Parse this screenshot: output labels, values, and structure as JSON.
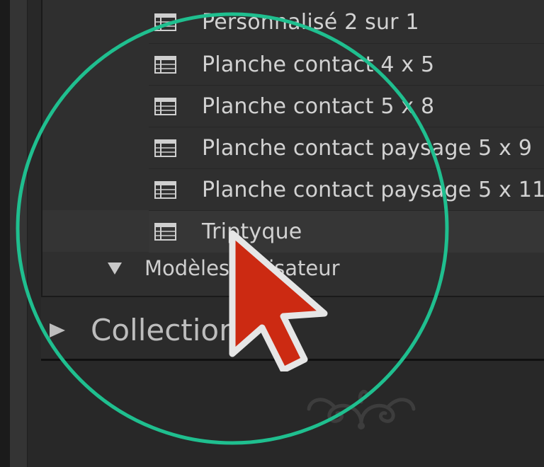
{
  "templates": {
    "items": [
      {
        "label": "Personnalisé 2 sur 1",
        "icon": "page-template-icon"
      },
      {
        "label": "Planche contact 4 x 5",
        "icon": "page-template-icon"
      },
      {
        "label": "Planche contact 5 x 8",
        "icon": "page-template-icon"
      },
      {
        "label": "Planche contact paysage 5 x 9",
        "icon": "page-template-icon"
      },
      {
        "label": "Planche contact paysage 5 x 11",
        "icon": "page-template-icon"
      },
      {
        "label": "Triptyque",
        "icon": "page-template-icon"
      }
    ],
    "selected_index": 5
  },
  "user_templates": {
    "label": "Modèles utilisateur",
    "expanded": true
  },
  "collections": {
    "label": "Collections",
    "expanded": false
  },
  "colors": {
    "highlight_ring": "#1fbf8f",
    "cursor_fill": "#cc2a12",
    "cursor_outline": "#e6e6e6",
    "text": "#d2d2d2",
    "panel_bg": "#2f2f2f"
  }
}
